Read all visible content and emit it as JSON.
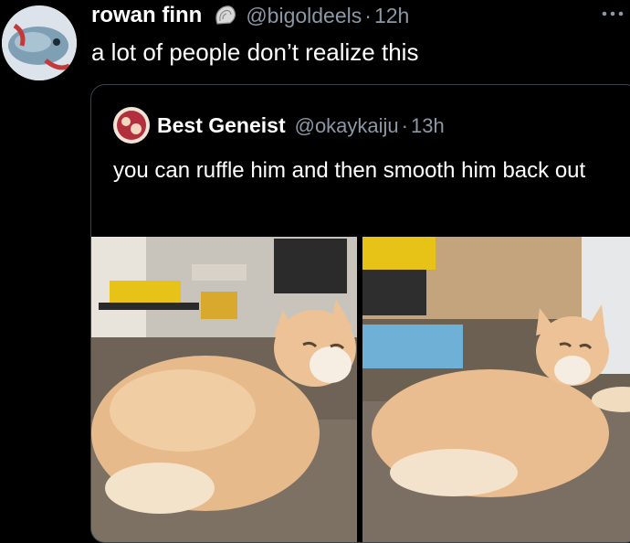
{
  "tweet": {
    "author_name": "rowan finn",
    "author_handle": "@bigoldeels",
    "separator": "·",
    "time": "12h",
    "text": "a lot of people don’t realize this",
    "badge_icon": "shell-icon",
    "more_icon": "more-icon"
  },
  "quoted_tweet": {
    "author_name": "Best Geneist",
    "author_handle": "@okaykaiju",
    "separator": "·",
    "time": "13h",
    "text": "you can ruffle him and then smooth him back out"
  },
  "colors": {
    "background": "#000000",
    "text_primary": "#ffffff",
    "text_secondary": "#8b98a5",
    "border": "#38444d",
    "cat_fur": "#e6b98a"
  }
}
